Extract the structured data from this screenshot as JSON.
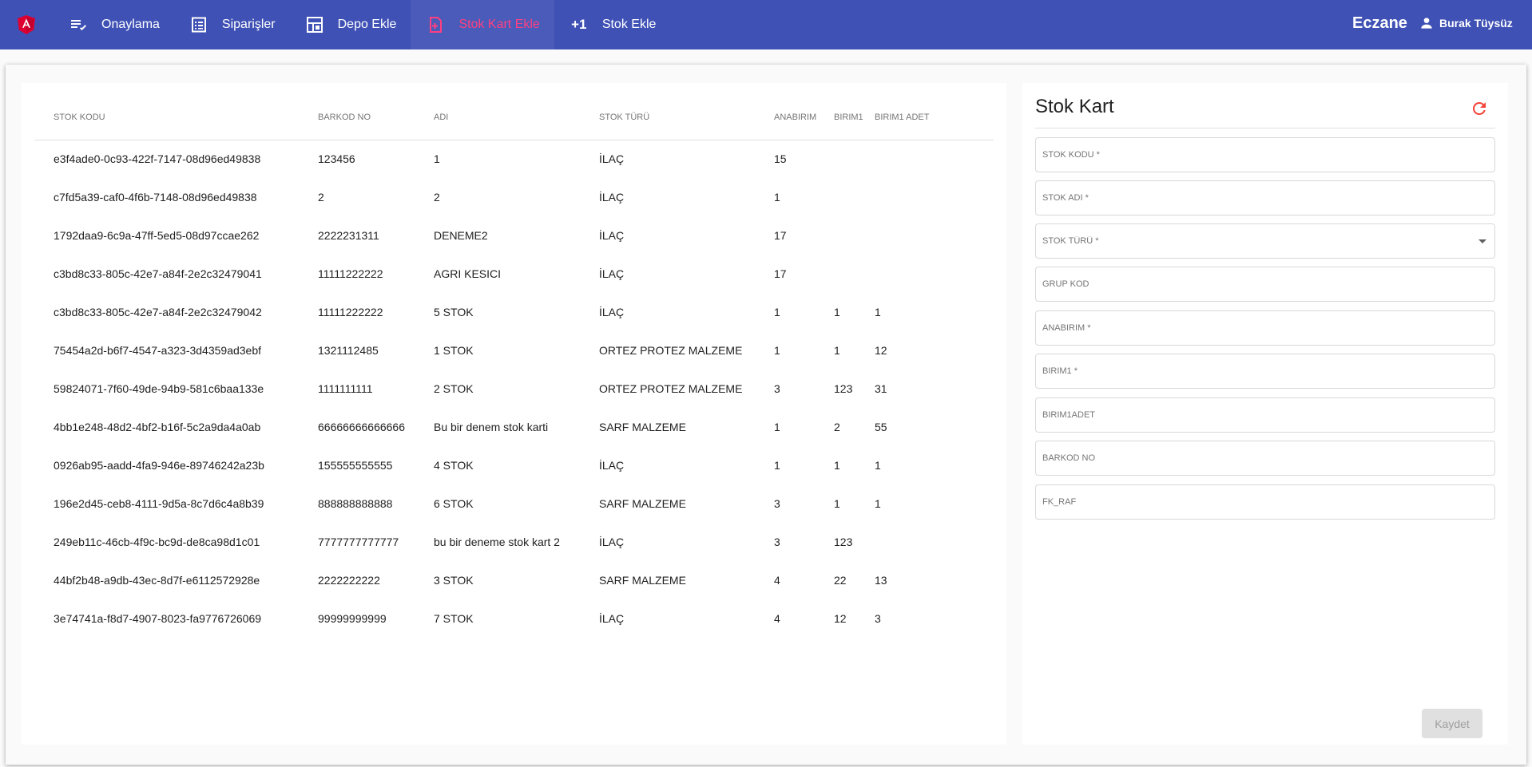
{
  "topbar": {
    "logo_icon": "angular-logo-icon",
    "nav": [
      {
        "label": "Onaylama",
        "icon": "playlist-check-icon"
      },
      {
        "label": "Siparişler",
        "icon": "list-alt-icon"
      },
      {
        "label": "Depo Ekle",
        "icon": "dashboard-icon"
      },
      {
        "label": "Stok Kart Ekle",
        "icon": "note-add-icon",
        "active": true
      },
      {
        "label": "Stok Ekle",
        "icon": "plus-one-icon",
        "icon_text": "+1"
      }
    ],
    "brand": "Eczane",
    "user": "Burak Tüysüz"
  },
  "colors": {
    "primary": "#3f51b5",
    "accent": "#ff4081",
    "refresh": "#f44336"
  },
  "table": {
    "headers": [
      "STOK KODU",
      "BARKOD NO",
      "ADI",
      "STOK TÜRÜ",
      "ANABIRIM",
      "BIRIM1",
      "BIRIM1 ADET"
    ],
    "rows": [
      [
        "e3f4ade0-0c93-422f-7147-08d96ed49838",
        "123456",
        "1",
        "İLAÇ",
        "15",
        "",
        ""
      ],
      [
        "c7fd5a39-caf0-4f6b-7148-08d96ed49838",
        "2",
        "2",
        "İLAÇ",
        "1",
        "",
        ""
      ],
      [
        "1792daa9-6c9a-47ff-5ed5-08d97ccae262",
        "2222231311",
        "DENEME2",
        "İLAÇ",
        "17",
        "",
        ""
      ],
      [
        "c3bd8c33-805c-42e7-a84f-2e2c32479041",
        "11111222222",
        "AGRI KESICI",
        "İLAÇ",
        "17",
        "",
        ""
      ],
      [
        "c3bd8c33-805c-42e7-a84f-2e2c32479042",
        "11111222222",
        "5 STOK",
        "İLAÇ",
        "1",
        "1",
        "1"
      ],
      [
        "75454a2d-b6f7-4547-a323-3d4359ad3ebf",
        "1321112485",
        "1 STOK",
        "ORTEZ PROTEZ MALZEME",
        "1",
        "1",
        "12"
      ],
      [
        "59824071-7f60-49de-94b9-581c6baa133e",
        "1111111111",
        "2 STOK",
        "ORTEZ PROTEZ MALZEME",
        "3",
        "123",
        "31"
      ],
      [
        "4bb1e248-48d2-4bf2-b16f-5c2a9da4a0ab",
        "66666666666666",
        "Bu bir denem stok karti",
        "SARF MALZEME",
        "1",
        "2",
        "55"
      ],
      [
        "0926ab95-aadd-4fa9-946e-89746242a23b",
        "155555555555",
        "4 STOK",
        "İLAÇ",
        "1",
        "1",
        "1"
      ],
      [
        "196e2d45-ceb8-4111-9d5a-8c7d6c4a8b39",
        "888888888888",
        "6 STOK",
        "SARF MALZEME",
        "3",
        "1",
        "1"
      ],
      [
        "249eb11c-46cb-4f9c-bc9d-de8ca98d1c01",
        "7777777777777",
        "bu bir deneme stok kart 2",
        "İLAÇ",
        "3",
        "123",
        ""
      ],
      [
        "44bf2b48-a9db-43ec-8d7f-e6112572928e",
        "2222222222",
        "3 STOK",
        "SARF MALZEME",
        "4",
        "22",
        "13"
      ],
      [
        "3e74741a-f8d7-4907-8023-fa9776726069",
        "99999999999",
        "7 STOK",
        "İLAÇ",
        "4",
        "12",
        "3"
      ]
    ]
  },
  "form": {
    "title": "Stok Kart",
    "refresh_icon": "refresh-icon",
    "fields": [
      {
        "placeholder": "STOK KODU *",
        "value": ""
      },
      {
        "placeholder": "STOK ADI *",
        "value": ""
      },
      {
        "placeholder": "STOK TÜRÜ *",
        "value": "",
        "select": true
      },
      {
        "placeholder": "GRUP KOD",
        "value": ""
      },
      {
        "placeholder": "ANABIRIM *",
        "value": ""
      },
      {
        "placeholder": "BIRIM1 *",
        "value": ""
      },
      {
        "placeholder": "BIRIM1ADET",
        "value": ""
      },
      {
        "placeholder": "BARKOD NO",
        "value": ""
      },
      {
        "placeholder": "FK_RAF",
        "value": ""
      }
    ],
    "save_label": "Kaydet"
  }
}
